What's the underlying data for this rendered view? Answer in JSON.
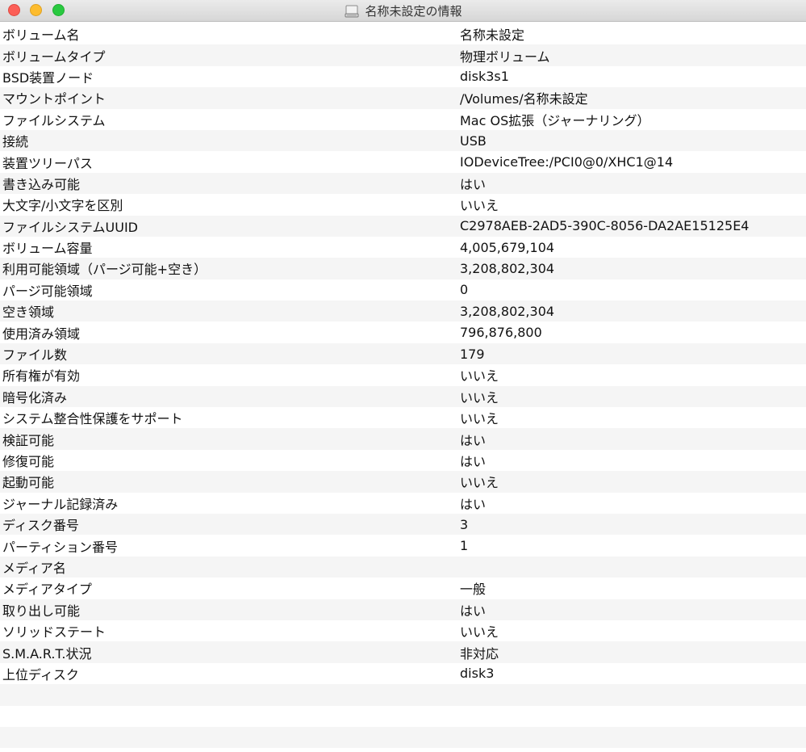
{
  "window": {
    "title": "名称未設定の情報",
    "title_icon": "disk-icon"
  },
  "rows": [
    {
      "label": "ボリューム名",
      "value": "名称未設定"
    },
    {
      "label": "ボリュームタイプ",
      "value": "物理ボリューム"
    },
    {
      "label": "BSD装置ノード",
      "value": "disk3s1"
    },
    {
      "label": "マウントポイント",
      "value": "/Volumes/名称未設定"
    },
    {
      "label": "ファイルシステム",
      "value": "Mac OS拡張（ジャーナリング）"
    },
    {
      "label": "接続",
      "value": "USB"
    },
    {
      "label": "装置ツリーパス",
      "value": "IODeviceTree:/PCI0@0/XHC1@14"
    },
    {
      "label": "書き込み可能",
      "value": "はい"
    },
    {
      "label": "大文字/小文字を区別",
      "value": "いいえ"
    },
    {
      "label": "ファイルシステムUUID",
      "value": "C2978AEB-2AD5-390C-8056-DA2AE15125E4"
    },
    {
      "label": "ボリューム容量",
      "value": "4,005,679,104"
    },
    {
      "label": "利用可能領域（パージ可能+空き）",
      "value": "3,208,802,304"
    },
    {
      "label": "パージ可能領域",
      "value": "0"
    },
    {
      "label": "空き領域",
      "value": "3,208,802,304"
    },
    {
      "label": "使用済み領域",
      "value": "796,876,800"
    },
    {
      "label": "ファイル数",
      "value": "179"
    },
    {
      "label": "所有権が有効",
      "value": "いいえ"
    },
    {
      "label": "暗号化済み",
      "value": "いいえ"
    },
    {
      "label": "システム整合性保護をサポート",
      "value": "いいえ"
    },
    {
      "label": "検証可能",
      "value": "はい"
    },
    {
      "label": "修復可能",
      "value": "はい"
    },
    {
      "label": "起動可能",
      "value": "いいえ"
    },
    {
      "label": "ジャーナル記録済み",
      "value": "はい"
    },
    {
      "label": "ディスク番号",
      "value": "3"
    },
    {
      "label": "パーティション番号",
      "value": "1"
    },
    {
      "label": "メディア名",
      "value": ""
    },
    {
      "label": "メディアタイプ",
      "value": "一般"
    },
    {
      "label": "取り出し可能",
      "value": "はい"
    },
    {
      "label": "ソリッドステート",
      "value": "いいえ"
    },
    {
      "label": "S.M.A.R.T.状況",
      "value": "非対応"
    },
    {
      "label": "上位ディスク",
      "value": "disk3"
    },
    {
      "label": "",
      "value": ""
    },
    {
      "label": "",
      "value": ""
    },
    {
      "label": "",
      "value": ""
    }
  ]
}
